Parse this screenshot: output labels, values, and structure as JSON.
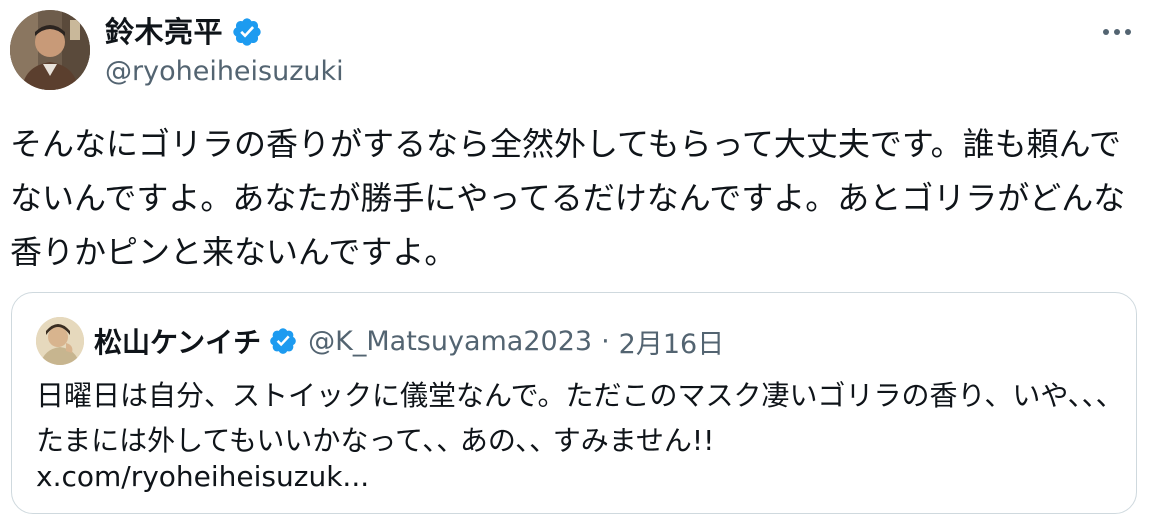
{
  "author": {
    "name": "鈴木亮平",
    "handle": "@ryoheiheisuzuki",
    "verified": true,
    "verified_color": "#1d9bf0"
  },
  "tweet": {
    "text": "そんなにゴリラの香りがするなら全然外してもらって大丈夫です。誰も頼んでないんですよ。あなたが勝手にやってるだけなんですよ。あとゴリラがどんな香りかピンと来ないんですよ。"
  },
  "quote": {
    "name": "松山ケンイチ",
    "handle": "@K_Matsuyama2023",
    "separator": "·",
    "date": "2月16日",
    "verified": true,
    "text": "日曜日は自分、ストイックに儀堂なんで。ただこのマスク凄いゴリラの香り、いや､､､ たまには外してもいいかなって､､ あの､､ すみません!!",
    "link": "x.com/ryoheiheisuzuk..."
  },
  "icons": {
    "more": "more-horizontal-icon",
    "verified": "verified-badge-icon"
  },
  "colors": {
    "text_primary": "#0f1419",
    "text_secondary": "#536471",
    "border": "#cfd9de",
    "accent": "#1d9bf0"
  }
}
